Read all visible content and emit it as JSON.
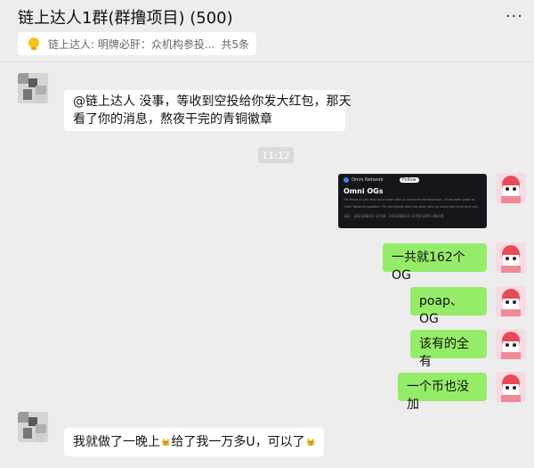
{
  "header": {
    "title": "链上达人1群(群撸项目) (500)",
    "more_icon": "···"
  },
  "notice": {
    "icon": "bulb-icon",
    "text": "链上达人: 明牌必肝：众机构参投...",
    "count": "共5条"
  },
  "messages": [
    {
      "side": "left",
      "text_line1": "@链上达人 没事，等收到空投给你发大红包，那天",
      "text_line2": "看了你的消息，熬夜干完的青铜徽章"
    },
    {
      "side": "time",
      "text": "11:12"
    },
    {
      "side": "right",
      "type": "image-card",
      "card": {
        "name": "Omni Network",
        "follow": "Follow",
        "title": "Omni OGs",
        "desc1": "For those of you who have been with us since the earliest days. It has been great to",
        "desc2": "Omni Network possible. For everybody who has been with us since last cycle and com",
        "meta": "162 · 2023/08/10 12:00 - 2023/08/20 12:00 GMT+08:00"
      }
    },
    {
      "side": "right",
      "text": "一共就162个OG"
    },
    {
      "side": "right",
      "text": "poap、OG"
    },
    {
      "side": "right",
      "text": "该有的全有"
    },
    {
      "side": "right",
      "text": "一个币也没加"
    },
    {
      "side": "left",
      "text_part1": "我就做了一晚上",
      "text_part2": "给了我一万多U，可以了"
    }
  ],
  "colors": {
    "bubble_green": "#95ec69",
    "bubble_white": "#ffffff",
    "bg": "#ededed"
  }
}
